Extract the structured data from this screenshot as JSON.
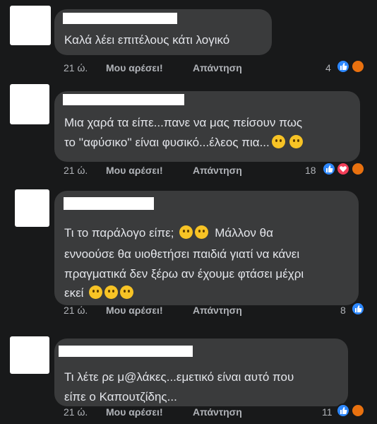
{
  "comments": [
    {
      "text_lines": [
        "Καλά λέει επιτέλους κάτι λογικό"
      ],
      "time": "21 ώ.",
      "like_label": "Μου αρέσει!",
      "reply_label": "Απάντηση",
      "reaction_count": "4",
      "reactions": [
        "like-icon",
        "angry-icon"
      ]
    },
    {
      "text_lines": [
        "Μια χαρά τα είπε...πανε να μας πείσουν πως",
        "το ''αφύσικο'' είναι φυσικό...έλεος πια..."
      ],
      "time": "21 ώ.",
      "like_label": "Μου αρέσει!",
      "reply_label": "Απάντηση",
      "reaction_count": "18",
      "reactions": [
        "like-icon",
        "heart-icon",
        "angry-icon"
      ],
      "inline_emojis": [
        "shushing-face-emoji",
        "thinking-face-emoji"
      ]
    },
    {
      "text_lines": [
        "Τι το παράλογο είπε;",
        "εννοούσε θα υιοθετήσει παιδιά γιατί να κάνει",
        "πραγματικά δεν ξέρω αν έχουμε φτάσει μέχρι",
        "εκεί"
      ],
      "line1_suffix": "Μάλλον θα",
      "time": "21 ώ.",
      "like_label": "Μου αρέσει!",
      "reply_label": "Απάντηση",
      "reaction_count": "8",
      "reactions": [
        "like-icon"
      ],
      "inline_emojis": [
        "thinking-face-emoji",
        "thinking-face-emoji",
        "winking-tongue-emoji",
        "grinning-emoji",
        "rofl-emoji"
      ]
    },
    {
      "text_lines": [
        "Τι λέτε ρε μ@λάκες...εμετικό είναι αυτό που",
        "είπε ο Καπουτζίδης..."
      ],
      "time": "21 ώ.",
      "like_label": "Μου αρέσει!",
      "reply_label": "Απάντηση",
      "reaction_count": "11",
      "reactions": [
        "like-icon",
        "angry-icon"
      ]
    }
  ],
  "colors": {
    "background": "#18191a",
    "bubble": "#3a3b3c",
    "text": "#e4e6eb",
    "secondary": "#b0b3b8",
    "like": "#2d88ff",
    "heart": "#f33e58",
    "angry": "#f7b125"
  }
}
